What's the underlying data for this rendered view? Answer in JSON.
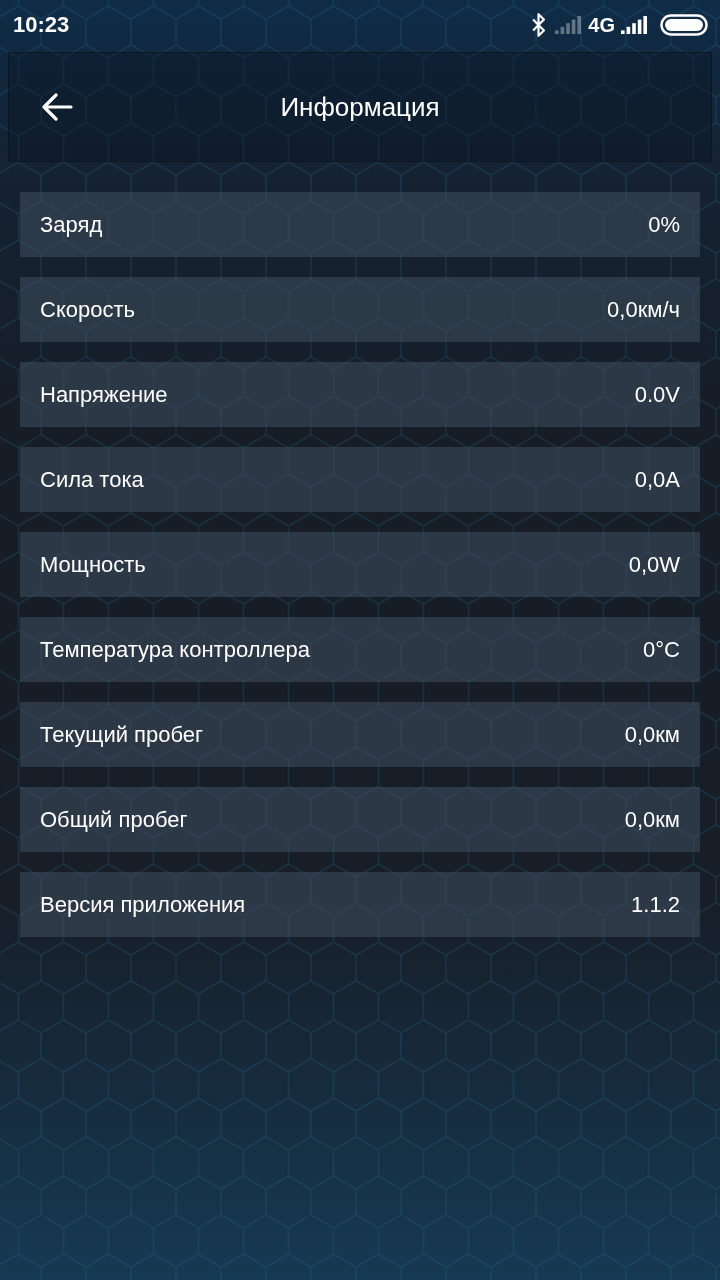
{
  "status_bar": {
    "time": "10:23",
    "network": "4G"
  },
  "header": {
    "title": "Информация"
  },
  "rows": [
    {
      "label": "Заряд",
      "value": "0%"
    },
    {
      "label": "Скорость",
      "value": "0,0км/ч"
    },
    {
      "label": "Напряжение",
      "value": "0.0V"
    },
    {
      "label": "Сила тока",
      "value": "0,0A"
    },
    {
      "label": "Мощность",
      "value": "0,0W"
    },
    {
      "label": "Температура контроллера",
      "value": "0°C"
    },
    {
      "label": "Текущий пробег",
      "value": "0,0км"
    },
    {
      "label": "Общий пробег",
      "value": "0,0км"
    },
    {
      "label": "Версия приложения",
      "value": "1.1.2"
    }
  ]
}
